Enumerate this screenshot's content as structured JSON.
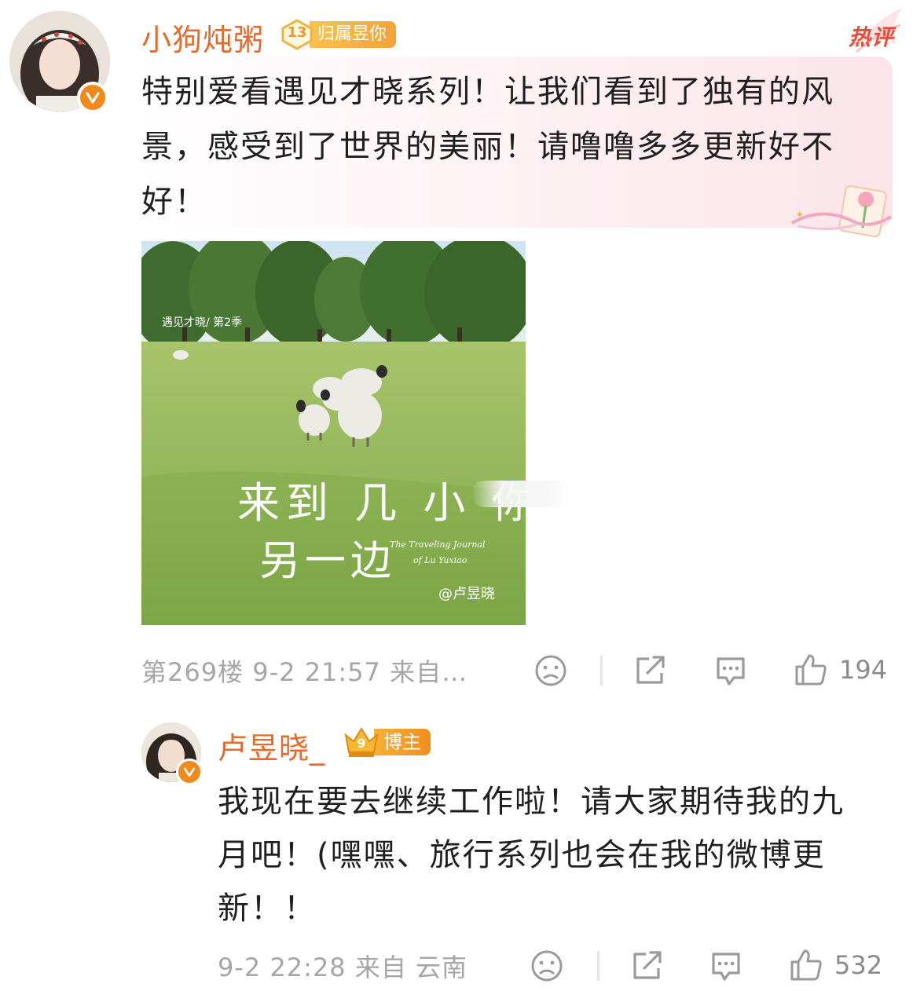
{
  "main_comment": {
    "username": "小狗炖粥",
    "fan_badge": {
      "level": "13",
      "label": "归属昱你"
    },
    "hot_tag": "热评",
    "text_lines": [
      "特别爱看遇见才晓系列！让我们看到了独有的风",
      "景，感受到了世界的美丽！请噜噜多多更新好不",
      "好！"
    ],
    "image": {
      "caption_top": "遇见才晓/ 第2季",
      "title_line1": "来到 几 小 你",
      "title_line2": "另一边",
      "subtitle_line1": "The Traveling Journal",
      "subtitle_line2": "of Lu Yuxiao",
      "watermark": "@卢昱晓"
    },
    "meta": "第269楼 9-2 21:57 来自…",
    "likes": "194"
  },
  "reply": {
    "username": "卢昱晓_",
    "host_badge": {
      "level": "9",
      "label": "博主"
    },
    "text_lines": [
      "我现在要去继续工作啦！请大家期待我的九",
      "月吧！(嘿嘿、旅行系列也会在我的微博更",
      "新！！"
    ],
    "meta": "9-2 22:28 来自 云南",
    "likes": "532"
  },
  "colors": {
    "username": "#e86a2b",
    "hot": "#e84b3a",
    "meta": "#a6a6a6",
    "icon": "#9a9a9a",
    "verify": "#f08a1c"
  }
}
